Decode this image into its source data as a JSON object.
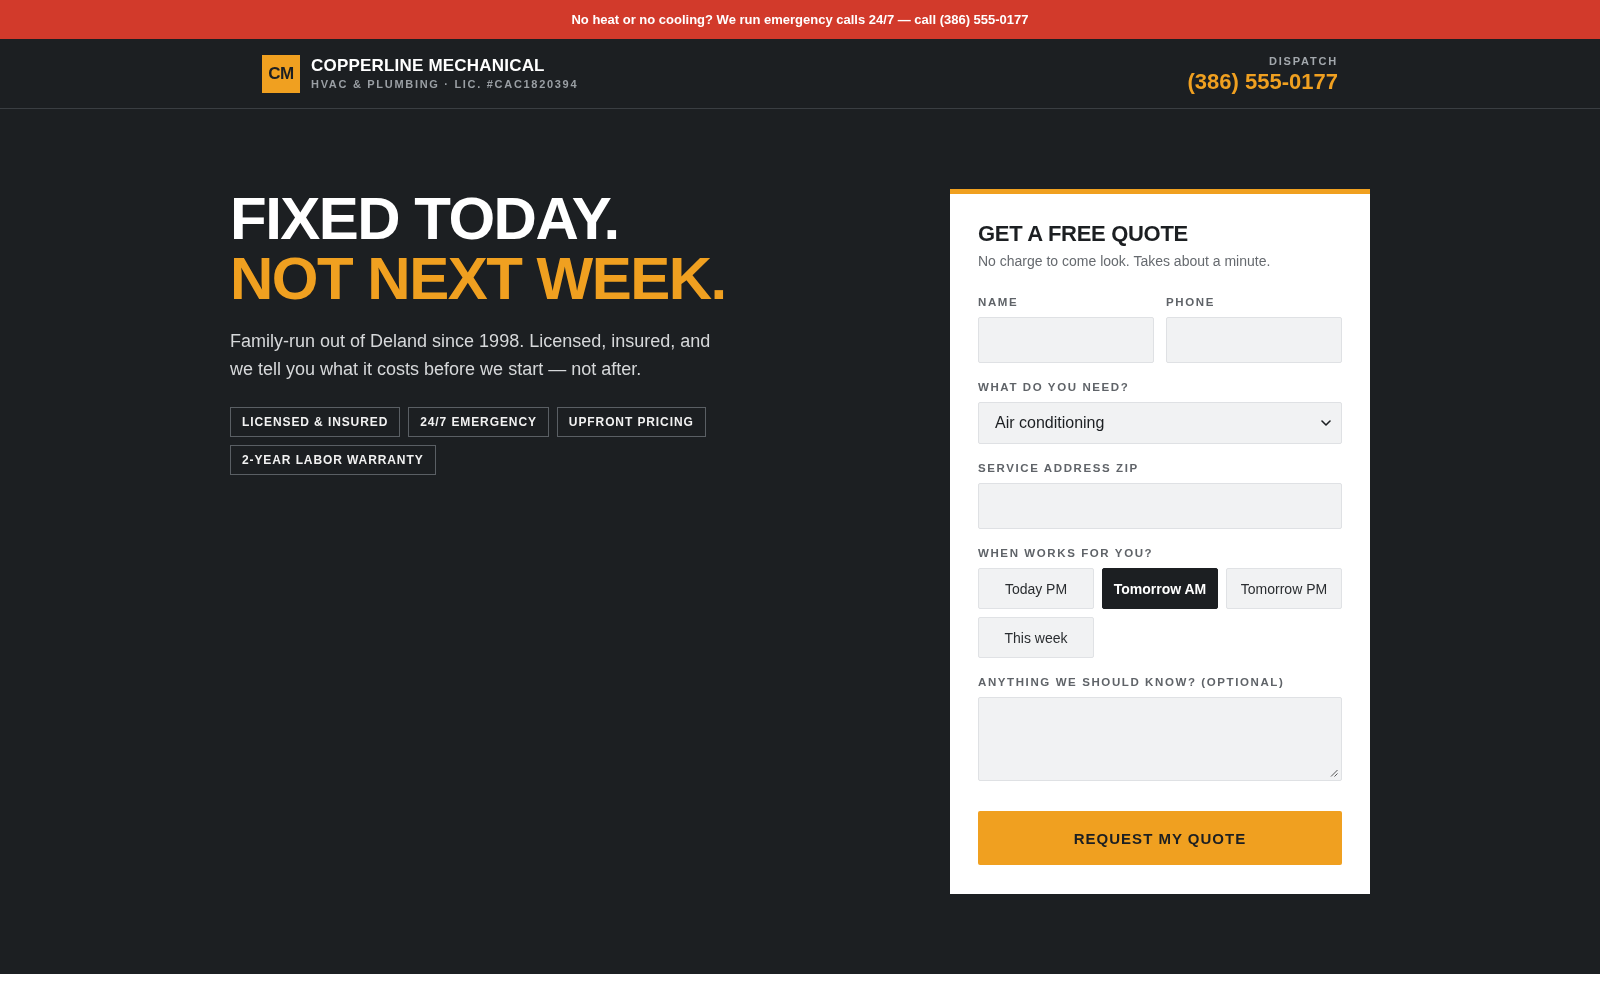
{
  "alert_bar": {
    "text": "No heat or no cooling? We run emergency calls 24/7 — call (386) 555-0177"
  },
  "header": {
    "logo_mark": "CM",
    "brand_name": "COPPERLINE MECHANICAL",
    "tagline": "HVAC & PLUMBING · LIC. #CAC1820394",
    "dispatch_label": "DISPATCH",
    "dispatch_phone": "(386) 555-0177"
  },
  "hero": {
    "headline": "FIXED TODAY.",
    "headline_highlight": "NOT NEXT WEEK.",
    "description": "Family-run out of Deland since 1998. Licensed, insured, and we tell you what it costs before we start — not after.",
    "badges": [
      "LICENSED & INSURED",
      "24/7 EMERGENCY",
      "UPFRONT PRICING",
      "2-YEAR LABOR WARRANTY"
    ]
  },
  "quote_form": {
    "title": "GET A FREE QUOTE",
    "subtitle": "No charge to come look. Takes about a minute.",
    "rows": [
      [
        {
          "kind": "text",
          "label": "NAME"
        },
        {
          "kind": "text",
          "label": "PHONE"
        }
      ],
      [
        {
          "kind": "select",
          "label": "WHAT DO YOU NEED?",
          "value": "Air conditioning"
        }
      ],
      [
        {
          "kind": "text",
          "label": "SERVICE ADDRESS ZIP"
        }
      ],
      [
        {
          "kind": "choice",
          "label": "WHEN WORKS FOR YOU?",
          "options": [
            {
              "label": "Today PM",
              "selected": false
            },
            {
              "label": "Tomorrow AM",
              "selected": true
            },
            {
              "label": "Tomorrow PM",
              "selected": false
            },
            {
              "label": "This week",
              "selected": false
            }
          ]
        }
      ],
      [
        {
          "kind": "textarea",
          "label": "ANYTHING WE SHOULD KNOW? (OPTIONAL)"
        }
      ]
    ],
    "submit_button": "REQUEST MY QUOTE"
  }
}
